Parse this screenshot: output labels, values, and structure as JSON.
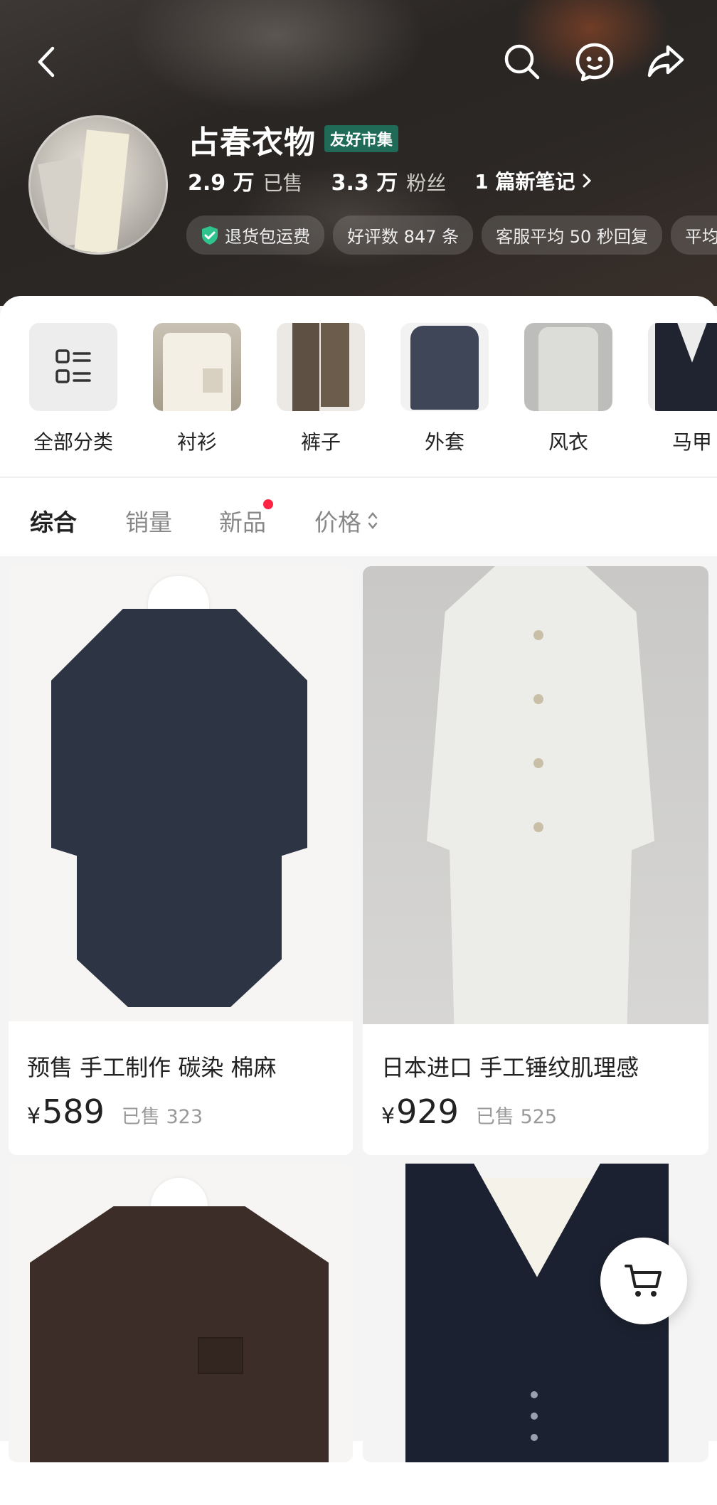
{
  "header": {
    "shop_name": "占春衣物",
    "badge": "友好市集",
    "sold_num": "2.9 万",
    "sold_label": "已售",
    "fans_num": "3.3 万",
    "fans_label": "粉丝",
    "notes": "1 篇新笔记",
    "tags": [
      "退货包运费",
      "好评数 847 条",
      "客服平均 50 秒回复",
      "平均"
    ]
  },
  "categories": [
    {
      "label": "全部分类",
      "icon": "grid-list-icon"
    },
    {
      "label": "衬衫"
    },
    {
      "label": "裤子"
    },
    {
      "label": "外套"
    },
    {
      "label": "风衣"
    },
    {
      "label": "马甲"
    }
  ],
  "sort_tabs": [
    {
      "label": "综合",
      "active": true
    },
    {
      "label": "销量"
    },
    {
      "label": "新品",
      "dot": true
    },
    {
      "label": "价格"
    }
  ],
  "products": [
    {
      "title": "预售 手工制作  碳染 棉麻",
      "currency": "¥",
      "price": "589",
      "sold": "已售 323"
    },
    {
      "title": "日本进口  手工锤纹肌理感",
      "currency": "¥",
      "price": "929",
      "sold": "已售 525"
    },
    {
      "title": "",
      "currency": "",
      "price": "",
      "sold": ""
    },
    {
      "title": "",
      "currency": "",
      "price": "",
      "sold": ""
    }
  ],
  "colors": {
    "accent_red": "#ff2442",
    "badge_green": "#1f6b58"
  }
}
